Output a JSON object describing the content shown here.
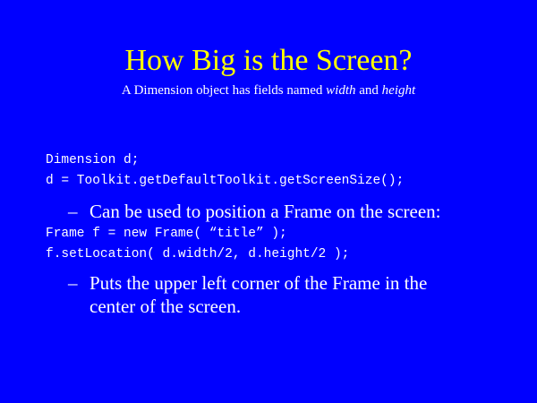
{
  "slide": {
    "title": "How Big is the Screen?",
    "subtitle": {
      "prefix": "A Dimension object has fields named ",
      "em1": "width",
      "mid": " and ",
      "em2": "height"
    },
    "code_block_1": [
      "Dimension d;",
      "d = Toolkit.getDefaultToolkit.getScreenSize();"
    ],
    "bullet_1": {
      "dash": "–",
      "text": "Can be used to position a Frame on the screen:"
    },
    "code_block_2": [
      "Frame f = new Frame( “title” );",
      "f.setLocation( d.width/2, d.height/2 );"
    ],
    "bullet_2": {
      "dash": "–",
      "line1": "Puts the upper left corner of the Frame in the",
      "line2": "center of the screen."
    }
  }
}
